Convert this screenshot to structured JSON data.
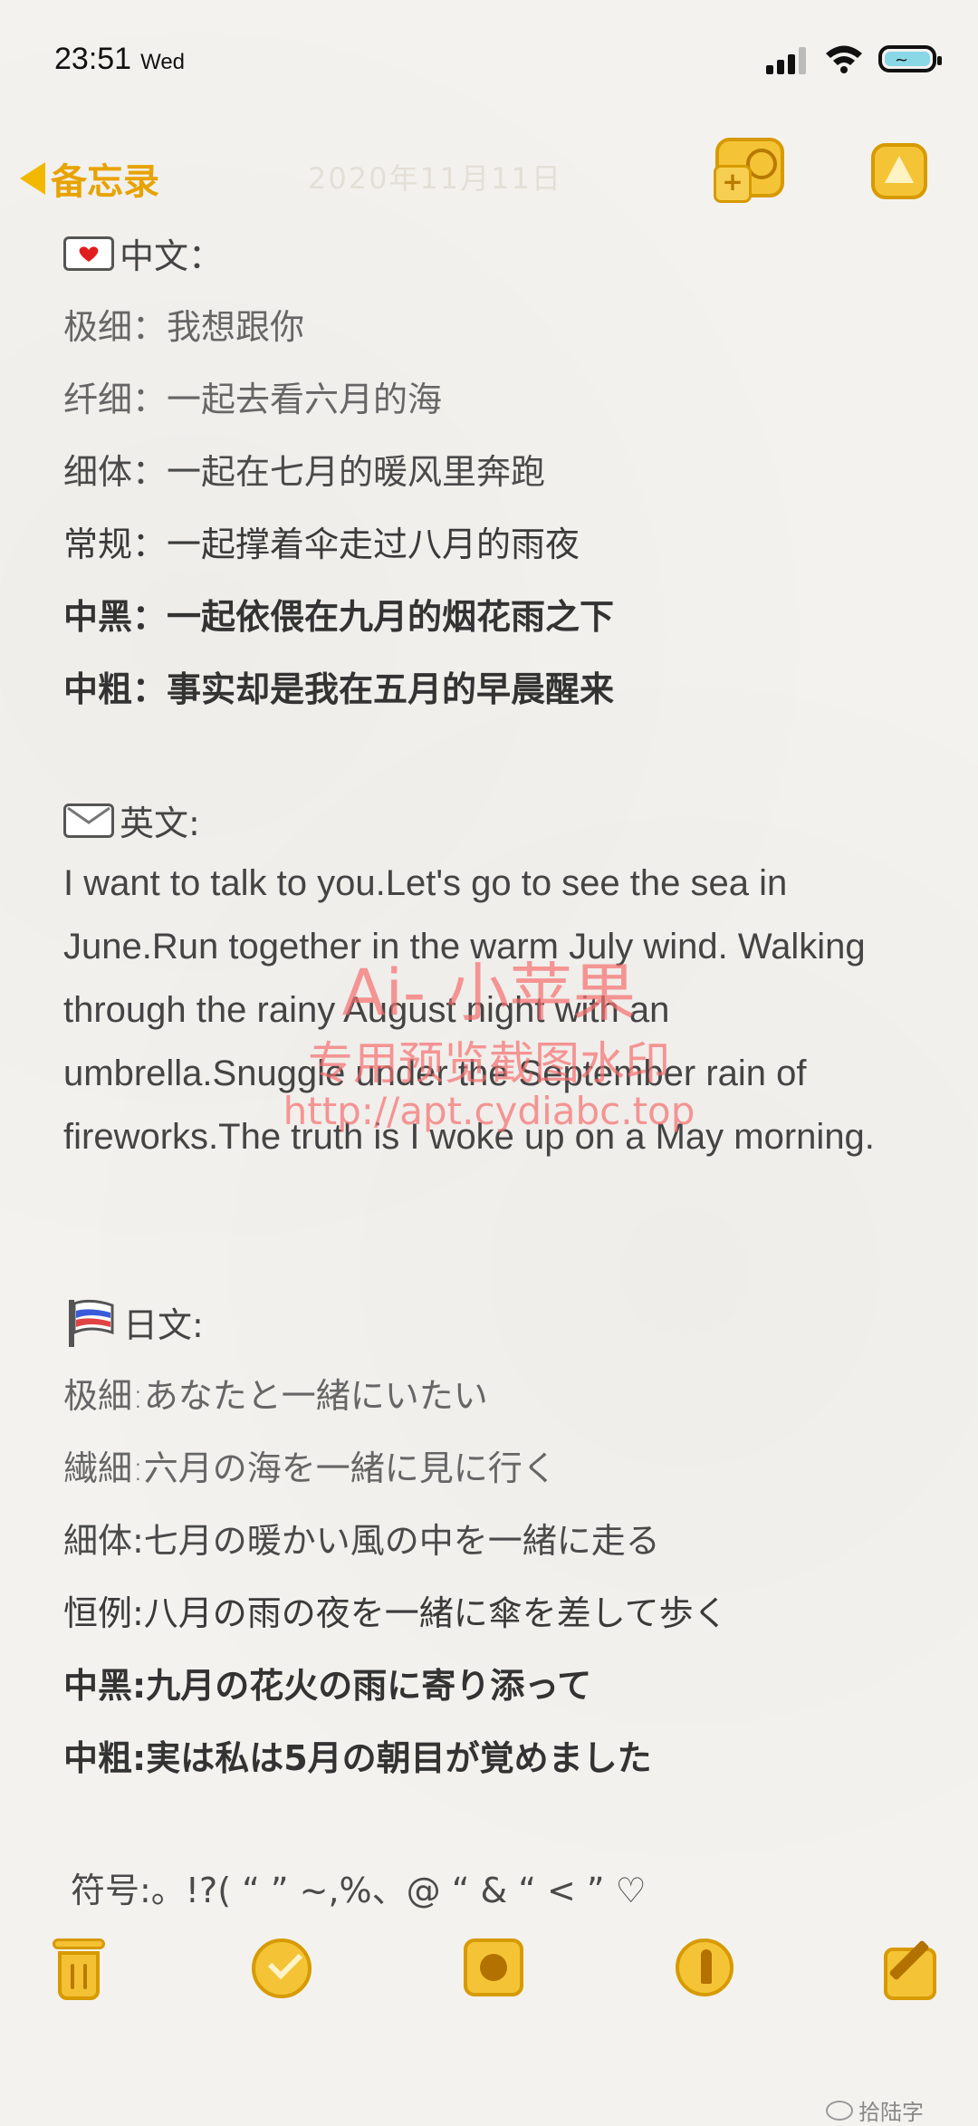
{
  "status_bar": {
    "time": "23:51",
    "day": "Wed"
  },
  "nav": {
    "back_label": "备忘录",
    "date_faint": "2020年11月11日"
  },
  "sections": {
    "chinese": {
      "header": "中文：",
      "lines": [
        {
          "weight": "极细",
          "text": "我想跟你"
        },
        {
          "weight": "纤细",
          "text": "一起去看六月的海"
        },
        {
          "weight": "细体",
          "text": "一起在七月的暖风里奔跑"
        },
        {
          "weight": "常规",
          "text": "一起撑着伞走过八月的雨夜"
        },
        {
          "weight": "中黑",
          "text": "一起依偎在九月的烟花雨之下"
        },
        {
          "weight": "中粗",
          "text": "事实却是我在五月的早晨醒来"
        }
      ]
    },
    "english": {
      "header": "英文:",
      "paragraph": "I want to talk to you.Let's go to see the sea in June.Run together in the warm July wind. Walking through the rainy August night with an umbrella.Snuggle under the September rain of fireworks.The truth is I woke up on a May morning."
    },
    "japanese": {
      "header": "日文:",
      "lines": [
        "极細:あなたと一緒にいたい",
        "繊細:六月の海を一緒に見に行く",
        "細体:七月の暖かい風の中を一緒に走る",
        "恒例:八月の雨の夜を一緒に傘を差して歩く",
        "中黑:九月の花火の雨に寄り添って",
        "中粗:実は私は5月の朝目が覚めました"
      ]
    },
    "symbols": {
      "text": "符号:。!?( “ ” ~,%、@ “ & “ < ” ♡"
    }
  },
  "watermark": {
    "line1": "Ai- 小苹果",
    "line2": "专用预览截图水印",
    "line3": "http://apt.cydiabc.top"
  },
  "footer": {
    "wechat": "拾陆字"
  },
  "icons": [
    "signal-icon",
    "wifi-icon",
    "battery-icon",
    "back-arrow-icon",
    "add-people-icon",
    "more-icon",
    "trash-icon",
    "checklist-icon",
    "camera-icon",
    "markup-icon",
    "compose-icon"
  ],
  "colors": {
    "accent": "#f4c436",
    "accent_dark": "#d79a00",
    "text": "#444444",
    "watermark": "#f66e6e"
  }
}
